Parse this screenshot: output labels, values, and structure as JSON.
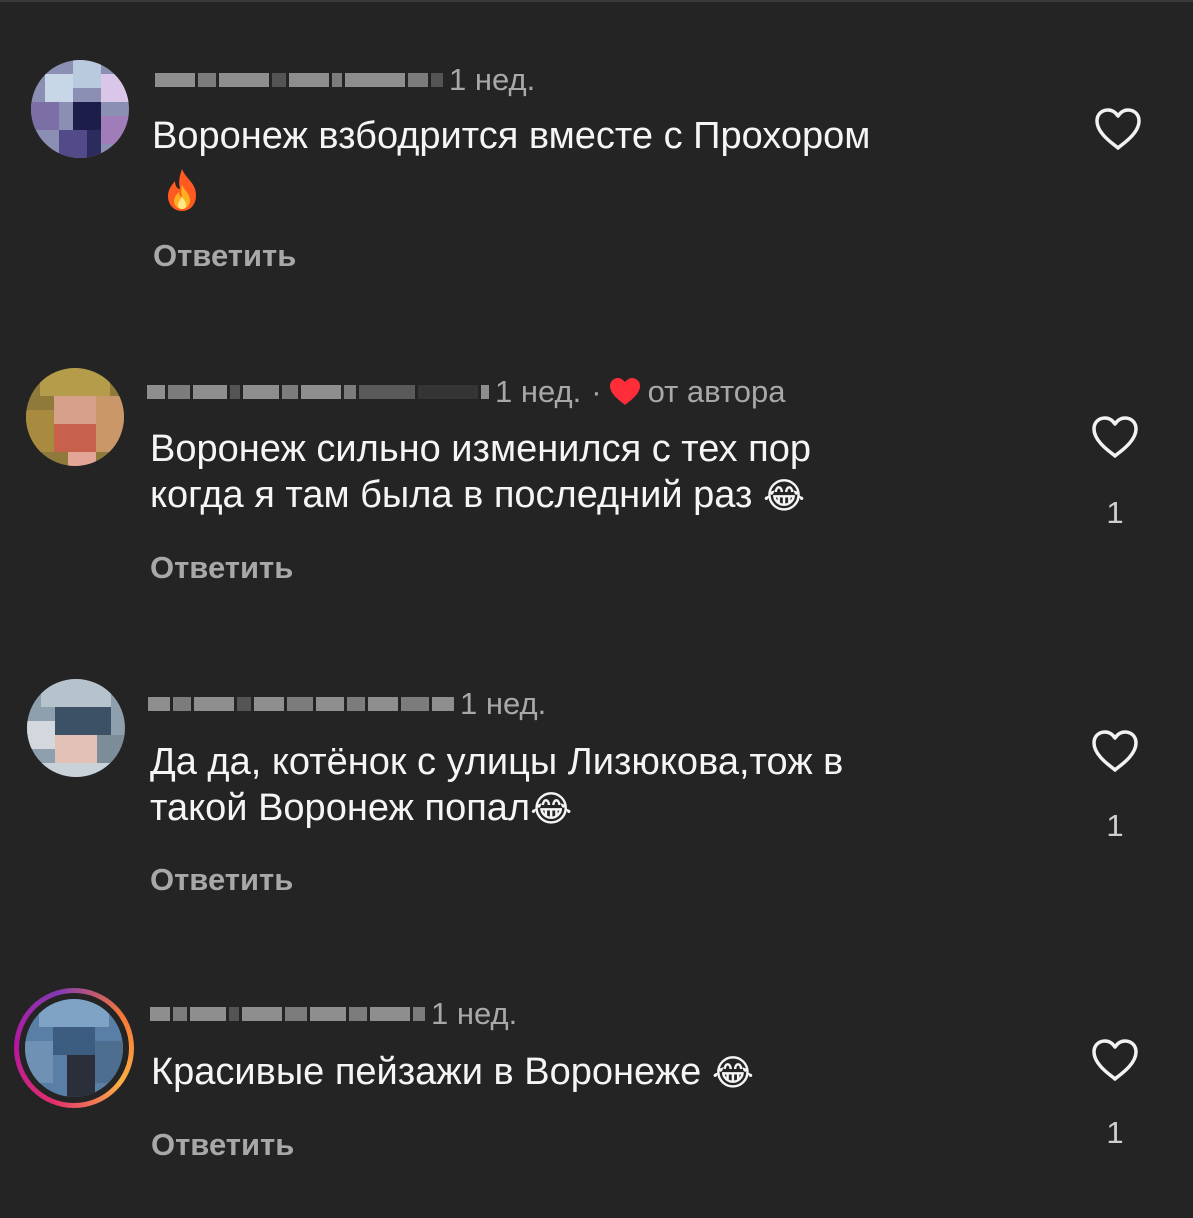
{
  "comments": [
    {
      "time": "1 нед.",
      "text_line1": "Воронеж взбодрится вместе с Прохором",
      "text_emoji": "🔥",
      "reply": "Ответить",
      "likes": ""
    },
    {
      "time": "1 нед.",
      "separator": "·",
      "author_badge": "от автора",
      "text_line1": "Воронеж сильно изменился с тех пор",
      "text_line2": "когда я там была в последний раз",
      "text_emoji": "😂",
      "reply": "Ответить",
      "likes": "1"
    },
    {
      "time": "1 нед.",
      "text_line1": "Да да, котёнок с улицы Лизюкова,тож в",
      "text_line2": "такой Воронеж попал",
      "text_emoji": "😂",
      "reply": "Ответить",
      "likes": "1"
    },
    {
      "time": "1 нед.",
      "text_line1": "Красивые пейзажи в Воронеже",
      "text_emoji": "😂",
      "reply": "Ответить",
      "likes": "1"
    }
  ],
  "colors": {
    "background": "#242424",
    "primary_text": "#f5f5f5",
    "secondary_text": "#a8a8a8",
    "author_heart": "#ff2d3a"
  },
  "icons": {
    "like": "heart-outline-icon",
    "author_like": "heart-filled-icon",
    "fire": "fire-emoji",
    "laugh": "tears-of-joy-emoji"
  }
}
